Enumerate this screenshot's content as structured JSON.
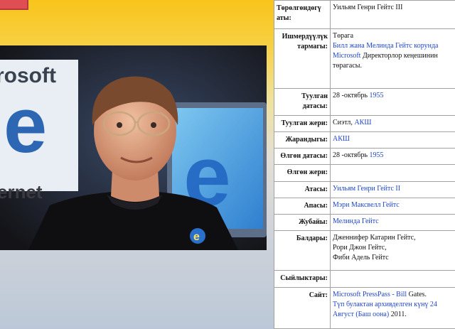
{
  "infobox": {
    "rows": [
      {
        "label": "Төрөлгөндөгү аты:",
        "value": [
          {
            "t": "Уильям Генри Гейтс III"
          }
        ]
      },
      {
        "label": "Ишмердүүлүк тармагы:",
        "value": [
          {
            "t": "Төрага"
          },
          {
            "br": true
          },
          {
            "t": "Билл жана Мелинда Гейтс корунда Microsoft",
            "link": true
          },
          {
            "t": " Директорлор кеңешинин төрагасы."
          }
        ]
      },
      {
        "label": "Туулган датасы:",
        "value": [
          {
            "t": "28 -октябрь "
          },
          {
            "t": "1955",
            "link": true
          }
        ]
      },
      {
        "label": "Туулган жери:",
        "value": [
          {
            "t": "Сиэтл, "
          },
          {
            "t": "АКШ",
            "link": true
          }
        ]
      },
      {
        "label": "Жарандыгы:",
        "value": [
          {
            "t": " АКШ",
            "link": true
          }
        ]
      },
      {
        "label": "Өлгөн датасы:",
        "value": [
          {
            "t": "28 -октябрь "
          },
          {
            "t": "1955",
            "link": true
          }
        ]
      },
      {
        "label": "Өлгөн жери:",
        "value": []
      },
      {
        "label": "Атасы:",
        "value": [
          {
            "t": "Уильям Генри Гейтс II",
            "link": true
          }
        ]
      },
      {
        "label": "Апасы:",
        "value": [
          {
            "t": "Мэри Максвелл Гейтс",
            "link": true
          }
        ]
      },
      {
        "label": "Жубайы:",
        "value": [
          {
            "t": "Мелинда Гейтс",
            "link": true
          }
        ]
      },
      {
        "label": "Балдары:",
        "value": [
          {
            "t": "Дженнифер Катарин Гейтс,"
          },
          {
            "br": true
          },
          {
            "t": "Рори Джон Гейтс,"
          },
          {
            "br": true
          },
          {
            "t": "Фиби Адель Гейтс"
          }
        ]
      },
      {
        "label": "Сыйлыктары:",
        "value": []
      },
      {
        "label": "Сайт:",
        "value": [
          {
            "t": "Microsoft PressPass - Bill",
            "link": true
          },
          {
            "t": " Gates."
          },
          {
            "br": true
          },
          {
            "t": "Түп булактан архивделген күнү 24 Август (Баш оона)",
            "link": true
          },
          {
            "t": " 2011."
          }
        ]
      }
    ]
  },
  "photo": {
    "bg_text_1": "rosoft",
    "bg_text_2": "ernet",
    "badge_text": "e",
    "bg_letter": "e"
  },
  "colors": {
    "link": "#1f45c8",
    "border": "#a2a2a2",
    "yellow": "#f9c41b",
    "badge": "#e04e54"
  }
}
